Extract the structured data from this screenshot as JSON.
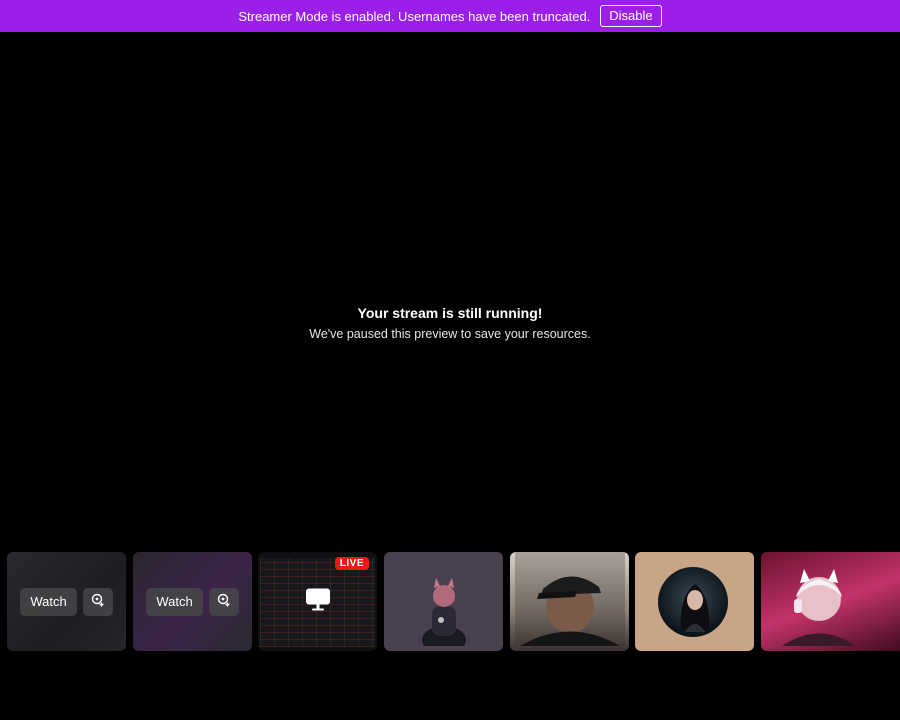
{
  "banner": {
    "message": "Streamer Mode is enabled. Usernames have been truncated.",
    "disable_label": "Disable",
    "color": "#9b1fe8"
  },
  "preview": {
    "title": "Your stream is still running!",
    "subtitle": "We've paused this preview to save your resources."
  },
  "stream_cards": {
    "watch_label": "Watch",
    "live_label": "LIVE",
    "items": [
      {
        "type": "watch",
        "icon": "add-screen-icon"
      },
      {
        "type": "watch",
        "icon": "add-screen-icon"
      },
      {
        "type": "live-screen",
        "icon": "monitor-icon"
      },
      {
        "type": "avatar"
      },
      {
        "type": "camera"
      },
      {
        "type": "avatar"
      },
      {
        "type": "camera"
      }
    ]
  }
}
